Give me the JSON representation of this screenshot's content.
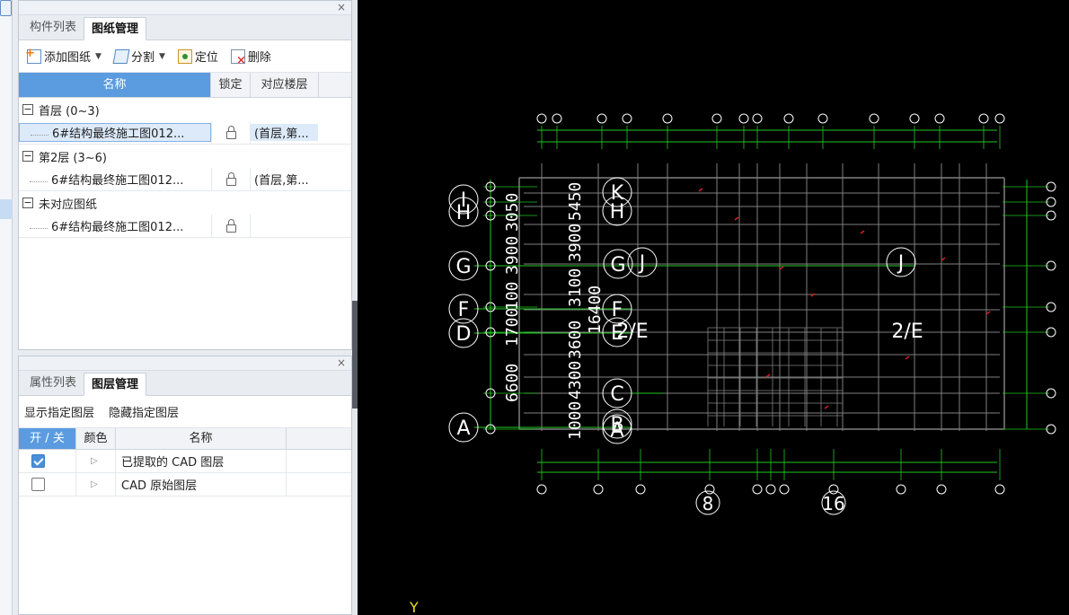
{
  "drawing_panel": {
    "close": "×",
    "tabs": [
      "构件列表",
      "图纸管理"
    ],
    "toolbar": {
      "add": "添加图纸",
      "split": "分割",
      "locate": "定位",
      "delete": "删除"
    },
    "columns": [
      "名称",
      "锁定",
      "对应楼层"
    ],
    "groups": [
      {
        "label": "首层 (0~3)",
        "expander": "−",
        "file": "6#结构最终施工图012...",
        "floor": "(首层,第..."
      },
      {
        "label": "第2层 (3~6)",
        "expander": "−",
        "file": "6#结构最终施工图012...",
        "floor": "(首层,第..."
      },
      {
        "label": "未对应图纸",
        "expander": "−",
        "file": "6#结构最终施工图012...",
        "floor": ""
      }
    ]
  },
  "layer_panel": {
    "close": "×",
    "tabs": [
      "属性列表",
      "图层管理"
    ],
    "actions": [
      "显示指定图层",
      "隐藏指定图层"
    ],
    "columns": [
      "开 / 关",
      "颜色",
      "名称"
    ],
    "rows": [
      {
        "checked": true,
        "color_mark": "▷",
        "name": "已提取的 CAD 图层"
      },
      {
        "checked": false,
        "color_mark": "▷",
        "name": "CAD 原始图层"
      }
    ]
  },
  "cad": {
    "colors": {
      "line": "#22c722",
      "text": "#ffffff",
      "grid": "#808080",
      "red": "#d42020",
      "bg": "#000000"
    },
    "axis_y_label": "Y",
    "big_labels": [
      "I",
      "H",
      "G",
      "F",
      "D",
      "A",
      "K",
      "H",
      "G",
      "J",
      "F",
      "E",
      "C",
      "B",
      "A",
      "J",
      "2/E",
      "2/E",
      "8",
      "16"
    ],
    "dim_texts": [
      "6600",
      "1700",
      "100",
      "3900",
      "3050",
      "1000",
      "4300",
      "3600",
      "3100",
      "3900",
      "5450",
      "16400"
    ]
  }
}
